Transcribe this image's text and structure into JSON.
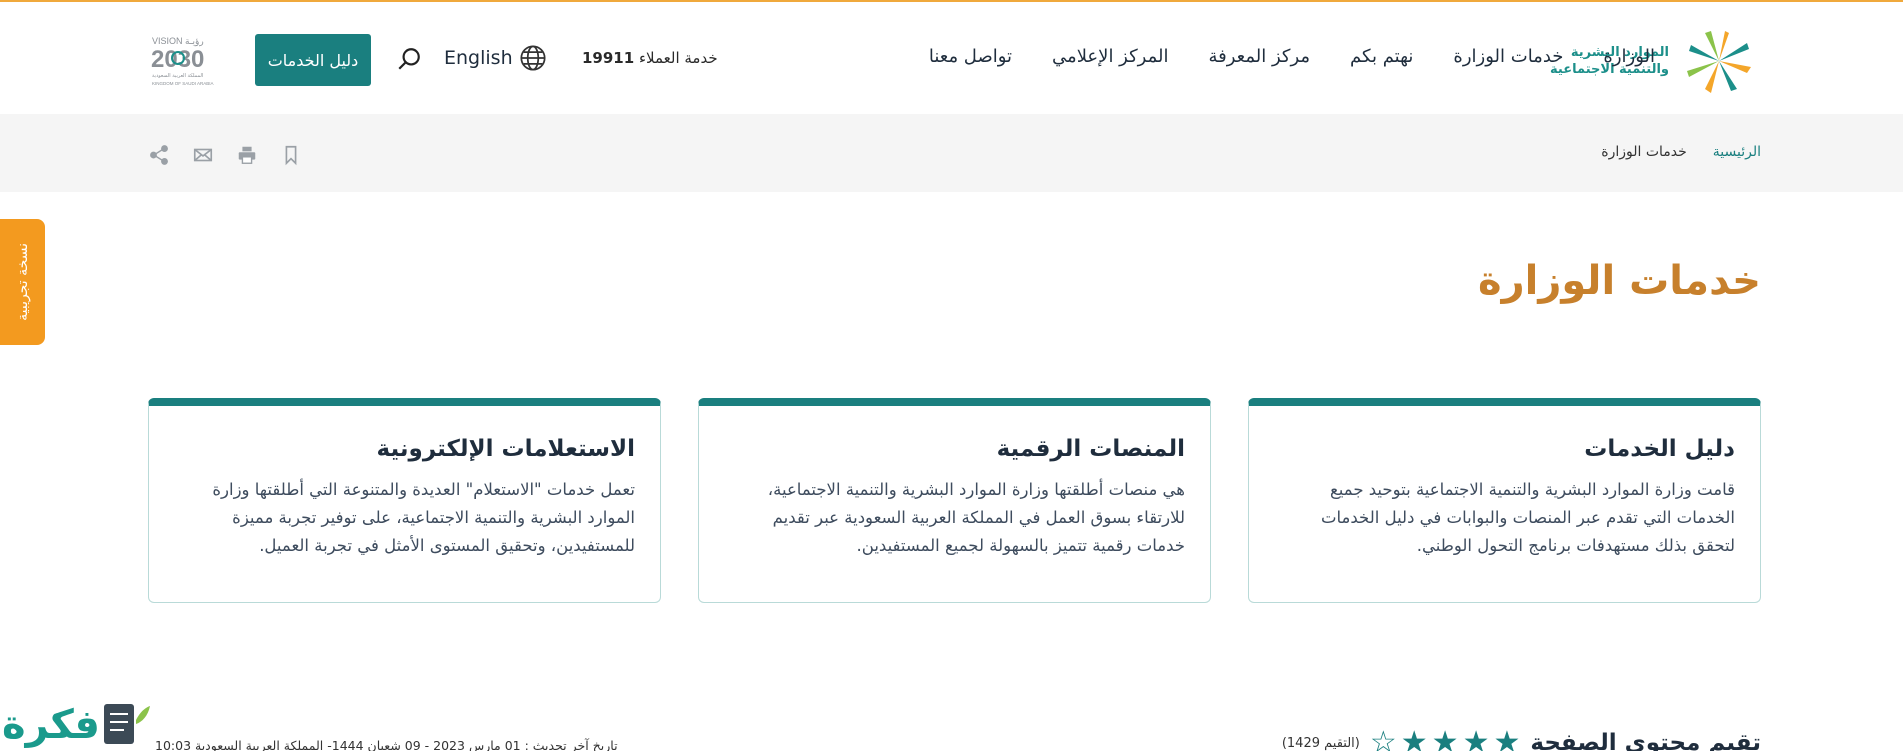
{
  "header": {
    "logo": {
      "line1": "الموارد البشرية",
      "line2": "والتنمية الاجتماعية"
    },
    "nav": [
      "الوزارة",
      "خدمات الوزارة",
      "نهتم بكم",
      "مركز المعرفة",
      "المركز الإعلامي",
      "تواصل معنا"
    ],
    "hotline_label": "خدمة العملاء",
    "hotline_number": "19911",
    "language": "English",
    "guide_button": "دليل الخدمات",
    "vision": {
      "top": "VISION رؤيـة",
      "year": "2030",
      "sub1": "المملكة العربية السعودية",
      "sub2": "KINGDOM OF SAUDI ARABIA"
    }
  },
  "breadcrumb": {
    "home": "الرئيسية",
    "current": "خدمات الوزارة"
  },
  "side_tab": "نسخة تجريبية",
  "page_title": "خدمات الوزارة",
  "cards": [
    {
      "title": "دليل الخدمات",
      "body": "قامت وزارة الموارد البشرية والتنمية الاجتماعية بتوحيد جميع الخدمات التي تقدم عبر المنصات والبوابات في دليل الخدمات لتحقق بذلك مستهدفات برنامج التحول الوطني."
    },
    {
      "title": "المنصات الرقمية",
      "body": "هي منصات أطلقتها وزارة الموارد البشرية والتنمية الاجتماعية، للارتقاء بسوق العمل في المملكة العربية السعودية عبر تقديم خدمات رقمية تتميز بالسهولة لجميع المستفيدين."
    },
    {
      "title": "الاستعلامات الإلكترونية",
      "body": "تعمل خدمات \"الاستعلام\" العديدة والمتنوعة التي أطلقتها وزارة الموارد البشرية والتنمية الاجتماعية، على توفير تجربة مميزة للمستفيدين، وتحقيق المستوى الأمثل في تجربة العميل."
    }
  ],
  "footer": {
    "rating_label": "تقيم محتوى الصفحة",
    "rating_value": 4,
    "rating_max": 5,
    "rating_count": "(التقيم 1429)",
    "last_updated": "تاريخ آخر تحديث : 01 مارس 2023 - 09 شعبان 1444- المملكة العربية السعودية 10:03"
  },
  "watermark": "فكرة",
  "colors": {
    "accent": "#1a7f7f",
    "title": "#c7802c",
    "side_tab": "#f39a1f",
    "top_line": "#f0a93c"
  },
  "icons": [
    "logo-star-icon",
    "globe-icon",
    "search-icon",
    "share-icon",
    "mail-icon",
    "print-icon",
    "bookmark-icon",
    "star-icon"
  ]
}
